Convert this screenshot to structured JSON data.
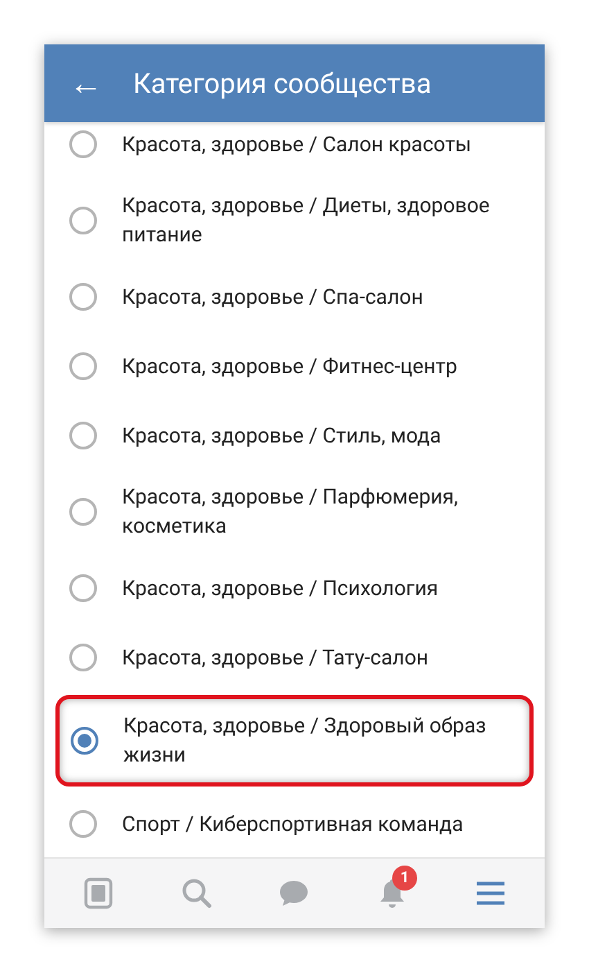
{
  "header": {
    "back_icon": "←",
    "title": "Категория сообщества"
  },
  "options": [
    {
      "label": "Красота, здоровье / Салон красоты",
      "selected": false,
      "highlighted": false
    },
    {
      "label": "Красота, здоровье / Диеты, здоровое питание",
      "selected": false,
      "highlighted": false
    },
    {
      "label": "Красота, здоровье / Спа-салон",
      "selected": false,
      "highlighted": false
    },
    {
      "label": "Красота, здоровье / Фитнес-центр",
      "selected": false,
      "highlighted": false
    },
    {
      "label": "Красота, здоровье / Стиль, мода",
      "selected": false,
      "highlighted": false
    },
    {
      "label": "Красота, здоровье / Парфюмерия, косметика",
      "selected": false,
      "highlighted": false
    },
    {
      "label": "Красота, здоровье / Психология",
      "selected": false,
      "highlighted": false
    },
    {
      "label": "Красота, здоровье / Тату-салон",
      "selected": false,
      "highlighted": false
    },
    {
      "label": "Красота, здоровье / Здоровый образ жизни",
      "selected": true,
      "highlighted": true
    },
    {
      "label": "Спорт / Киберспортивная команда",
      "selected": false,
      "highlighted": false
    }
  ],
  "bottom_nav": [
    {
      "kind": "news",
      "selected": false
    },
    {
      "kind": "search",
      "selected": false
    },
    {
      "kind": "messages",
      "selected": false
    },
    {
      "kind": "notifications",
      "selected": false,
      "badge": "1"
    },
    {
      "kind": "menu",
      "selected": true
    }
  ]
}
